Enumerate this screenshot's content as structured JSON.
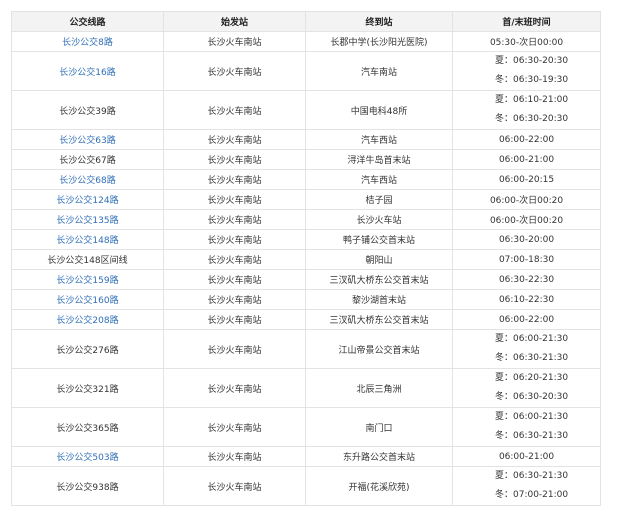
{
  "table": {
    "headers": [
      "公交线路",
      "始发站",
      "终到站",
      "首/末班时间"
    ],
    "rows": [
      {
        "line": "长沙公交8路",
        "link": true,
        "start": "长沙火车南站",
        "end": "长郡中学(长沙阳光医院)",
        "times": [
          "05:30-次日00:00"
        ]
      },
      {
        "line": "长沙公交16路",
        "link": true,
        "start": "长沙火车南站",
        "end": "汽车南站",
        "times": [
          "夏：06:30-20:30",
          "冬：06:30-19:30"
        ]
      },
      {
        "line": "长沙公交39路",
        "link": false,
        "start": "长沙火车南站",
        "end": "中国电科48所",
        "times": [
          "夏：06:10-21:00",
          "冬：06:30-20:30"
        ]
      },
      {
        "line": "长沙公交63路",
        "link": true,
        "start": "长沙火车南站",
        "end": "汽车西站",
        "times": [
          "06:00-22:00"
        ]
      },
      {
        "line": "长沙公交67路",
        "link": false,
        "start": "长沙火车南站",
        "end": "浔洋牛岛首末站",
        "times": [
          "06:00-21:00"
        ]
      },
      {
        "line": "长沙公交68路",
        "link": true,
        "start": "长沙火车南站",
        "end": "汽车西站",
        "times": [
          "06:00-20:15"
        ]
      },
      {
        "line": "长沙公交124路",
        "link": true,
        "start": "长沙火车南站",
        "end": "桔子园",
        "times": [
          "06:00-次日00:20"
        ]
      },
      {
        "line": "长沙公交135路",
        "link": true,
        "start": "长沙火车南站",
        "end": "长沙火车站",
        "times": [
          "06:00-次日00:20"
        ]
      },
      {
        "line": "长沙公交148路",
        "link": true,
        "start": "长沙火车南站",
        "end": "鸭子铺公交首末站",
        "times": [
          "06:30-20:00"
        ]
      },
      {
        "line": "长沙公交148区间线",
        "link": false,
        "start": "长沙火车南站",
        "end": "朝阳山",
        "times": [
          "07:00-18:30"
        ]
      },
      {
        "line": "长沙公交159路",
        "link": true,
        "start": "长沙火车南站",
        "end": "三汊矶大桥东公交首末站",
        "times": [
          "06:30-22:30"
        ]
      },
      {
        "line": "长沙公交160路",
        "link": true,
        "start": "长沙火车南站",
        "end": "黎沙湖首末站",
        "times": [
          "06:10-22:30"
        ]
      },
      {
        "line": "长沙公交208路",
        "link": true,
        "start": "长沙火车南站",
        "end": "三汊矶大桥东公交首末站",
        "times": [
          "06:00-22:00"
        ]
      },
      {
        "line": "长沙公交276路",
        "link": false,
        "start": "长沙火车南站",
        "end": "江山帝景公交首末站",
        "times": [
          "夏：06:00-21:30",
          "冬：06:30-21:30"
        ]
      },
      {
        "line": "长沙公交321路",
        "link": false,
        "start": "长沙火车南站",
        "end": "北辰三角洲",
        "times": [
          "夏：06:20-21:30",
          "冬：06:30-20:30"
        ]
      },
      {
        "line": "长沙公交365路",
        "link": false,
        "start": "长沙火车南站",
        "end": "南门口",
        "times": [
          "夏：06:00-21:30",
          "冬：06:30-21:30"
        ]
      },
      {
        "line": "长沙公交503路",
        "link": true,
        "start": "长沙火车南站",
        "end": "东升路公交首末站",
        "times": [
          "06:00-21:00"
        ]
      },
      {
        "line": "长沙公交938路",
        "link": false,
        "start": "长沙火车南站",
        "end": "开福(花溪欣苑)",
        "times": [
          "夏：06:30-21:30",
          "冬：07:00-21:00"
        ]
      }
    ]
  }
}
